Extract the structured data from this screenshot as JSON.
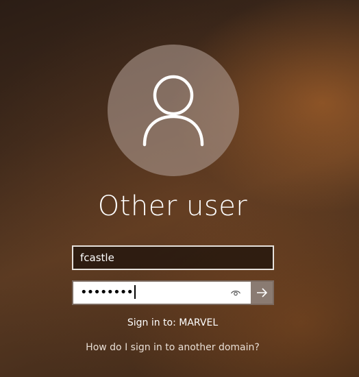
{
  "user": {
    "display_name": "Other user",
    "username_value": "fcastle",
    "password_masked": "••••••••"
  },
  "signin": {
    "sign_in_to": "Sign in to: MARVEL",
    "domain_help_link": "How do I sign in to another domain?"
  },
  "icons": {
    "avatar": "person-icon",
    "reveal": "eye-icon",
    "submit": "arrow-right-icon"
  },
  "colors": {
    "avatar_circle": "#aa968c",
    "submit_button": "#8a7b72"
  }
}
